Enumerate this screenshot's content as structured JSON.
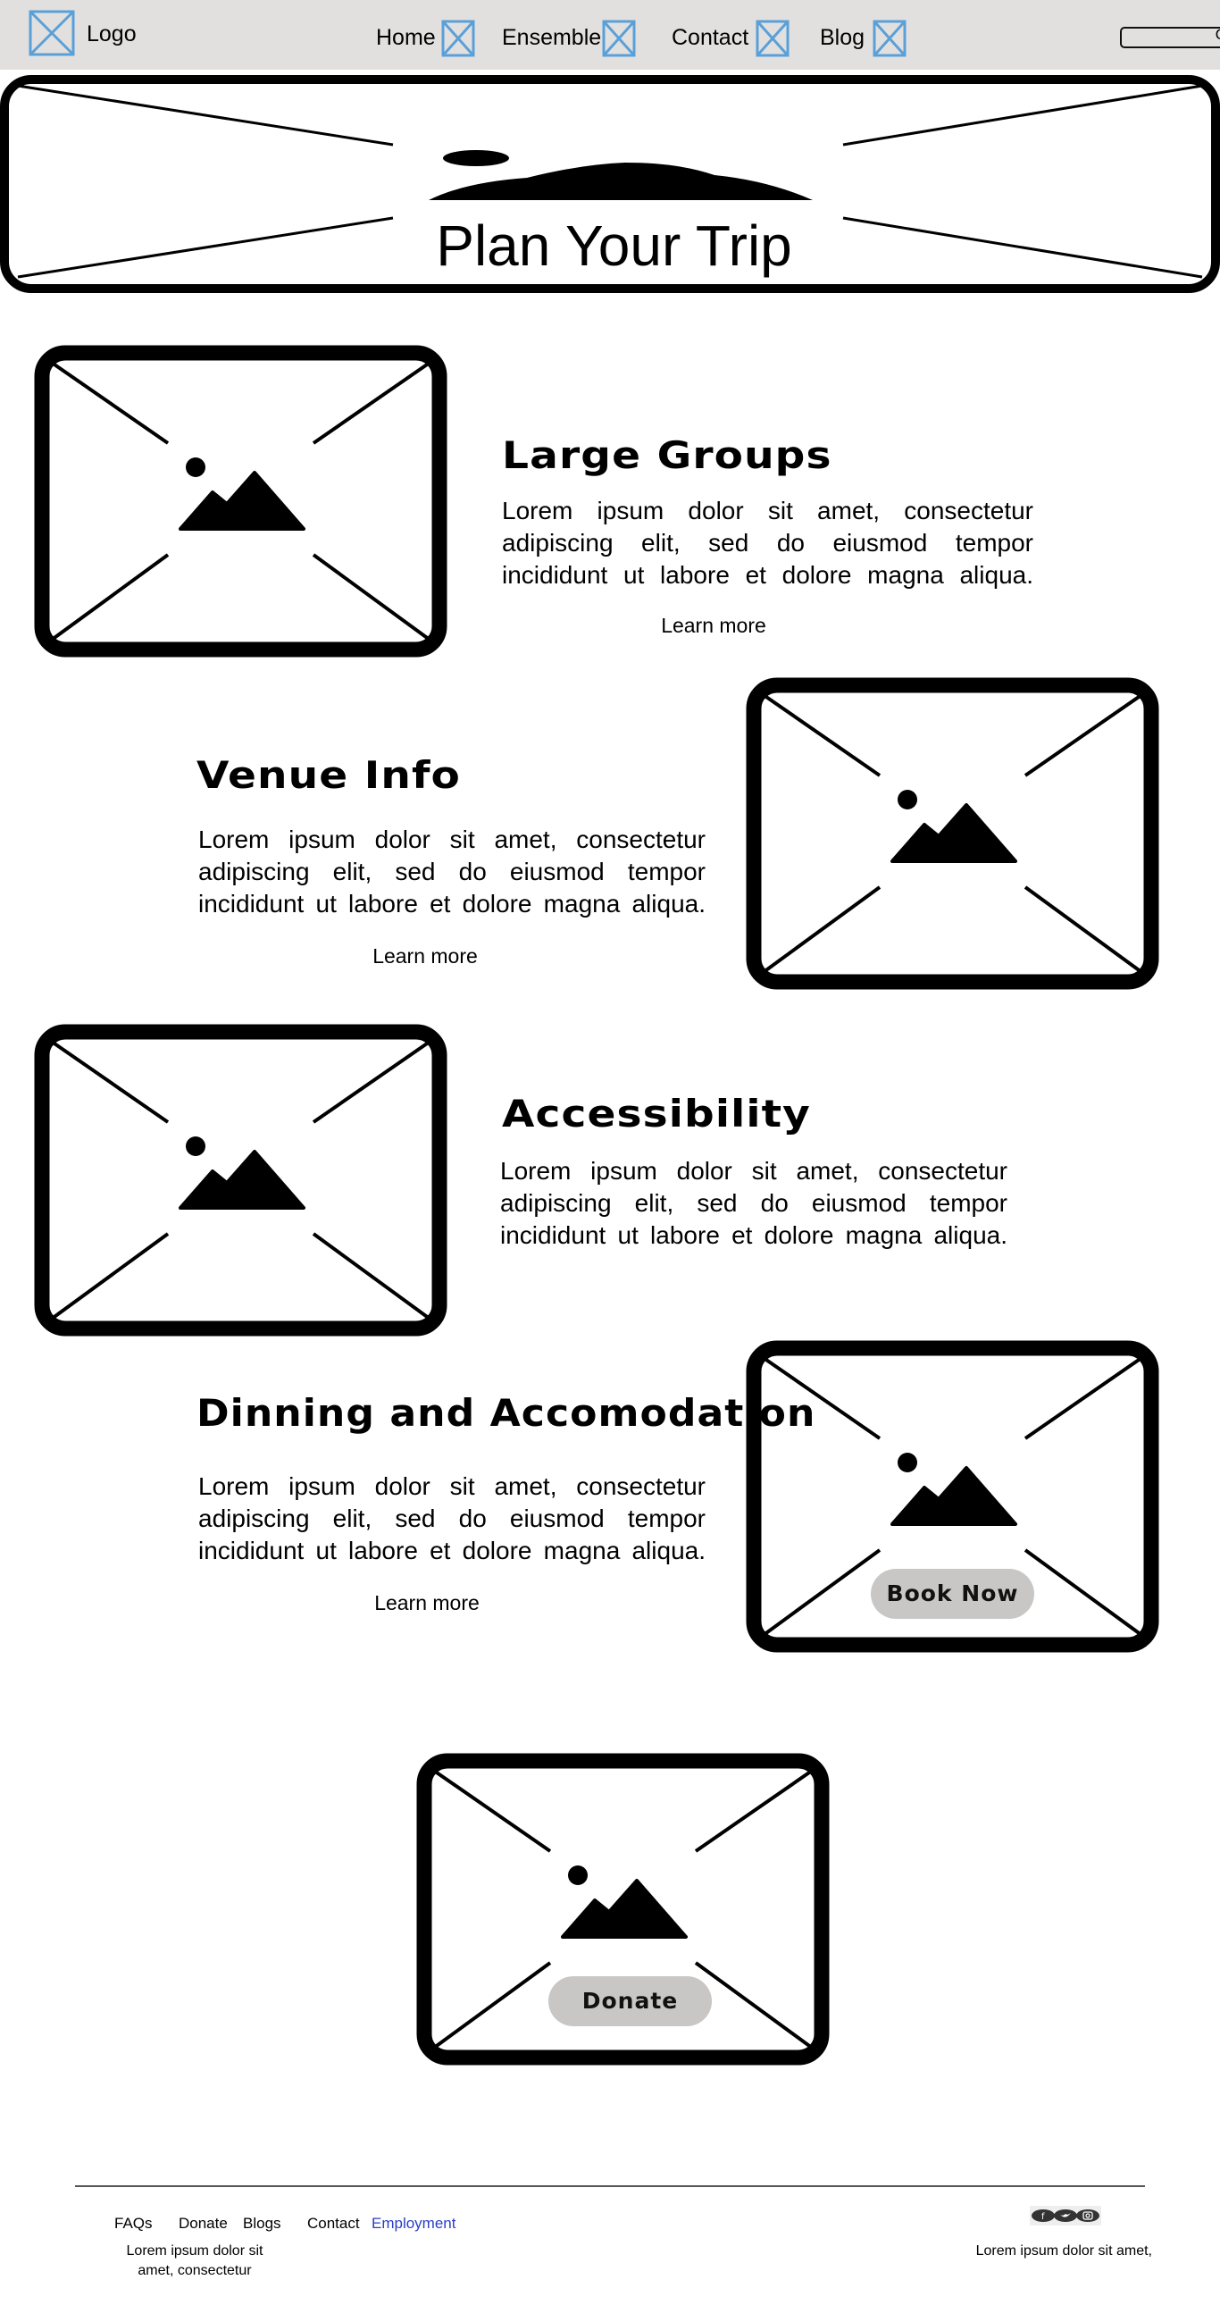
{
  "header": {
    "logo_label": "Logo",
    "nav": [
      {
        "label": "Home"
      },
      {
        "label": "Ensemble"
      },
      {
        "label": "Contact"
      },
      {
        "label": "Blog"
      }
    ],
    "search_icon_glyph": "Q"
  },
  "hero": {
    "title": "Plan Your Trip"
  },
  "sections": [
    {
      "title": "Large Groups",
      "lines": [
        "Lorem ipsum dolor sit amet, consectetur",
        "adipiscing elit, sed do eiusmod tempor",
        "incididunt ut labore et dolore magna aliqua."
      ],
      "link": "Learn more"
    },
    {
      "title": "Venue Info",
      "lines": [
        "Lorem ipsum dolor sit amet, consectetur",
        "adipiscing elit, sed do eiusmod tempor",
        "incididunt ut labore et dolore magna aliqua."
      ],
      "link": "Learn more"
    },
    {
      "title": "Accessibility",
      "lines": [
        "Lorem ipsum dolor sit amet, consectetur",
        "adipiscing elit, sed do eiusmod tempor",
        "incididunt ut labore et dolore magna aliqua."
      ]
    },
    {
      "title": "Dinning and Accomodation",
      "lines": [
        "Lorem ipsum dolor sit amet, consectetur",
        "adipiscing elit, sed do eiusmod tempor",
        "incididunt ut labore et dolore magna aliqua."
      ],
      "link": "Learn more",
      "button": "Book Now"
    }
  ],
  "donate": {
    "button": "Donate"
  },
  "footer": {
    "links": [
      {
        "label": "FAQs"
      },
      {
        "label": "Donate"
      },
      {
        "label": "Blogs"
      },
      {
        "label": "Contact"
      },
      {
        "label": "Employment"
      }
    ],
    "left_text": [
      "Lorem ipsum dolor sit",
      "amet, consectetur"
    ],
    "right_text": "Lorem ipsum dolor sit amet,",
    "social_icons": [
      "facebook-icon",
      "twitter-icon",
      "instagram-icon"
    ]
  },
  "colors": {
    "header_bg": "#e2e0df",
    "placeholder_icon_blue": "#5aa0d8",
    "button_bg": "#c9c7c6",
    "employment_link": "#2a3fc4"
  }
}
